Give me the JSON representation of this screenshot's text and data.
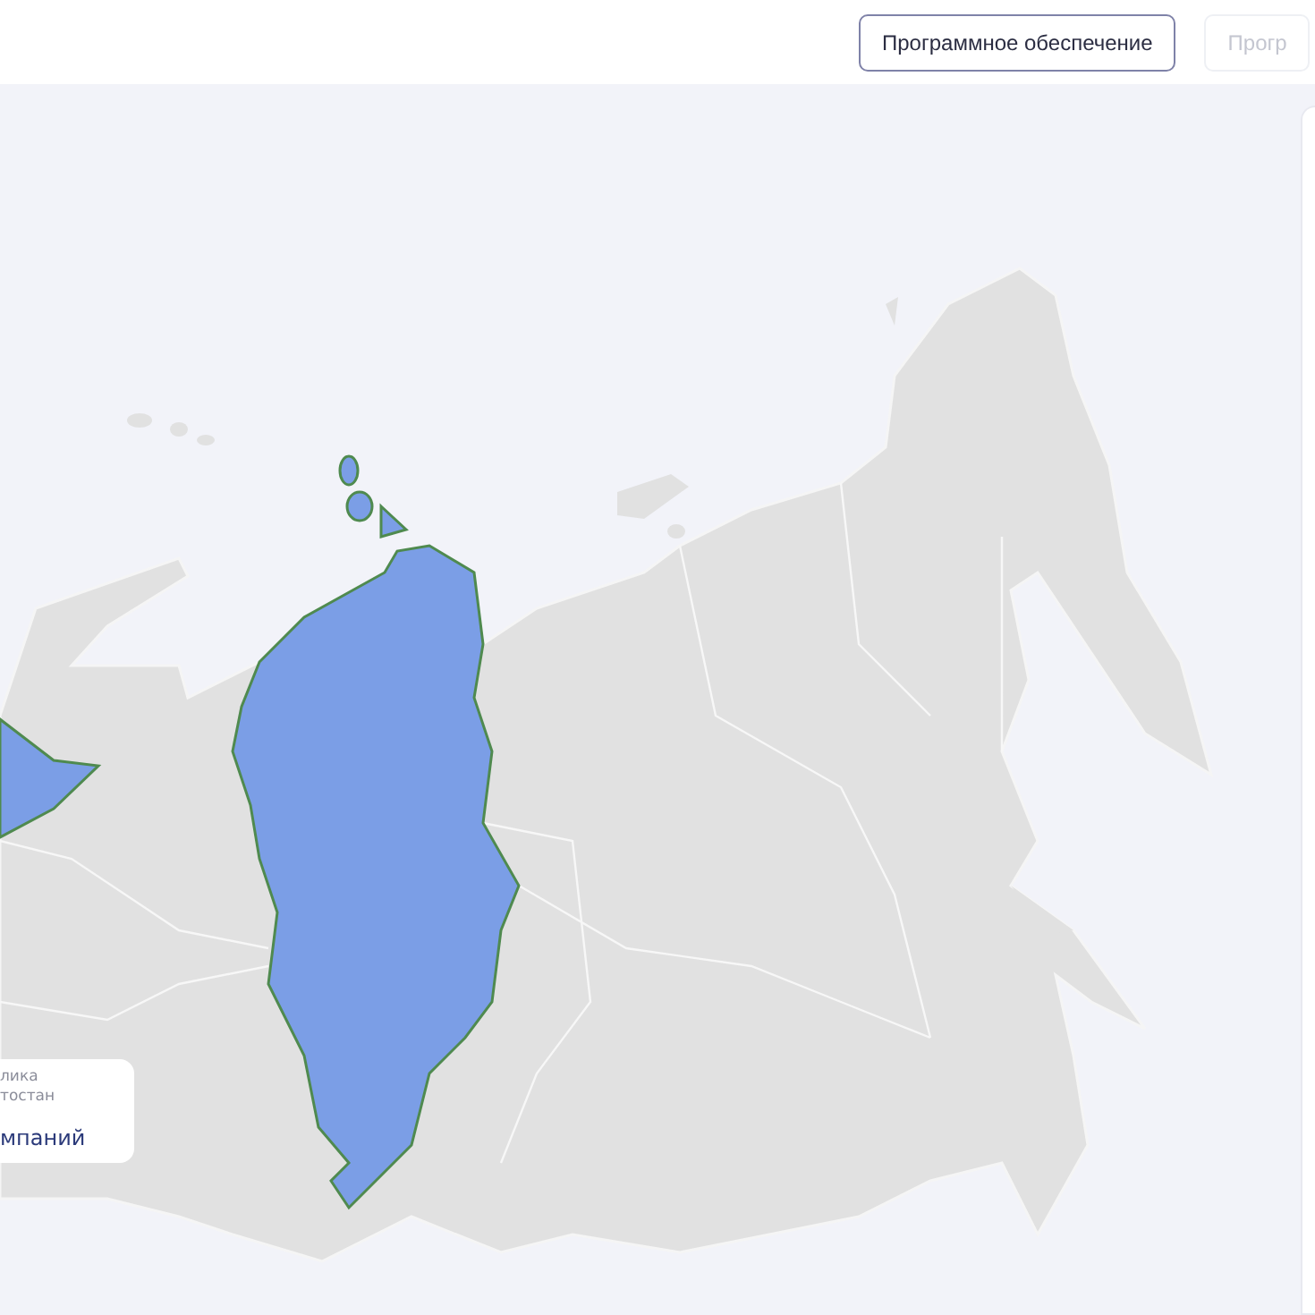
{
  "top_bar": {
    "buttons": [
      {
        "label": "Программное обеспечение",
        "selected": true
      },
      {
        "label": "Прогр",
        "selected": false
      }
    ]
  },
  "map": {
    "tooltip": {
      "region": "лика\nтостан",
      "count": "мпаний"
    }
  }
}
